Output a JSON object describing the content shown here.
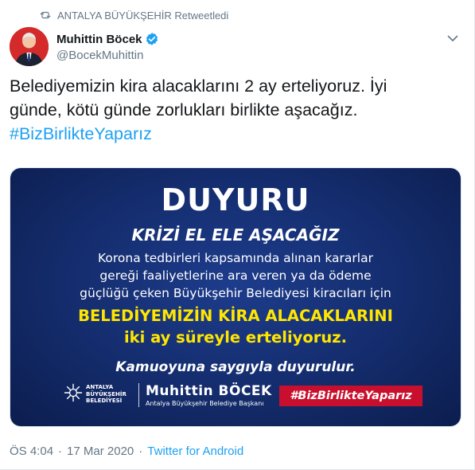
{
  "retweet": {
    "label": "ANTALYA BÜYÜKŞEHİR Retweetledi"
  },
  "author": {
    "name": "Muhittin Böcek",
    "handle": "@BocekMuhittin"
  },
  "tweet": {
    "line1": "Belediyemizin kira alacaklarını 2 ay erteliyoruz. İyi",
    "line2": "günde, kötü günde zorlukları birlikte aşacağız.",
    "hashtag": "#BizBirlikteYaparız"
  },
  "media": {
    "title": "DUYURU",
    "subtitle": "KRİZİ EL ELE AŞACAĞIZ",
    "body_line1": "Korona tedbirleri kapsamında alınan kararlar",
    "body_line2": "gereği faaliyetlerine ara veren ya da ödeme",
    "body_line3": "güçlüğü çeken Büyükşehir Belediyesi kiracıları için",
    "highlight_line1": "BELEDİYEMİZİN KİRA ALACAKLARINI",
    "highlight_line2": "iki ay süreyle erteliyoruz.",
    "closing": "Kamuoyuna saygıyla duyurulur.",
    "org_line1": "ANTALYA",
    "org_line2": "BÜYÜKŞEHİR",
    "org_line3": "BELEDİYESİ",
    "person_name": "Muhittin BÖCEK",
    "person_title": "Antalya Büyükşehir Belediye Başkanı",
    "tag": "#BizBirlikteYaparız"
  },
  "footer": {
    "time": "ÖS 4:04",
    "date": "17 Mar 2020",
    "separator": "·",
    "source": "Twitter for Android"
  },
  "colors": {
    "link": "#1da1f2",
    "muted": "#657786",
    "banner_bg": "#142c6c",
    "highlight": "#ffe600",
    "tag_bg": "#c8102e"
  },
  "icons": {
    "retweet": "retweet-icon",
    "verified": "verified-badge-icon",
    "menu": "chevron-down-icon"
  }
}
